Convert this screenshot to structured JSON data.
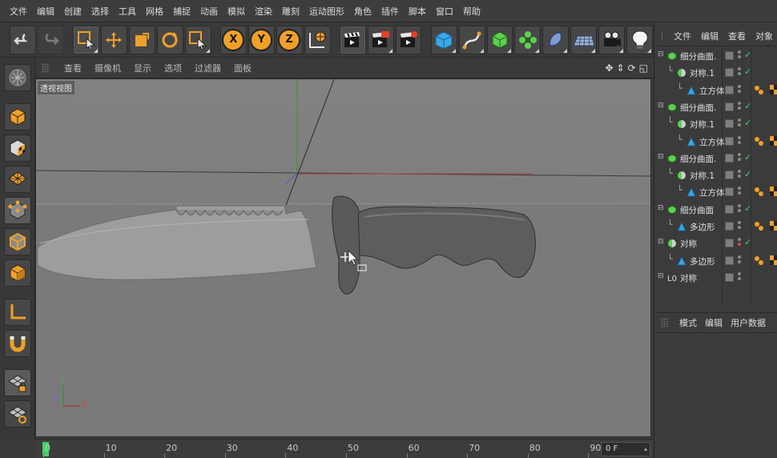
{
  "menu": [
    "文件",
    "编辑",
    "创建",
    "选择",
    "工具",
    "网格",
    "捕捉",
    "动画",
    "模拟",
    "渲染",
    "雕刻",
    "运动图形",
    "角色",
    "插件",
    "脚本",
    "窗口",
    "帮助"
  ],
  "toolbar": {
    "undo_icon": "undo-icon",
    "redo_icon": "redo-icon",
    "axis_x": "X",
    "axis_y": "Y",
    "axis_z": "Z"
  },
  "viewport": {
    "menu": [
      "查看",
      "摄像机",
      "显示",
      "选项",
      "过滤器",
      "面板"
    ],
    "label": "透视视图",
    "axis_y": "Y",
    "axis_z": "Z",
    "axis_x": "X"
  },
  "timeline": {
    "ticks": [
      "0",
      "10",
      "20",
      "30",
      "40",
      "50",
      "60",
      "70",
      "80",
      "90"
    ],
    "frame": "0 F"
  },
  "object_manager": {
    "menu": [
      "文件",
      "编辑",
      "查看",
      "对象"
    ],
    "rows": [
      {
        "name": "细分曲面.",
        "indent": 0,
        "type": "subdiv",
        "check": true
      },
      {
        "name": "对称.1",
        "indent": 1,
        "type": "symmetry",
        "check": true
      },
      {
        "name": "立方体",
        "indent": 2,
        "type": "poly",
        "check": false,
        "tags": true
      },
      {
        "name": "细分曲面.",
        "indent": 0,
        "type": "subdiv",
        "check": true
      },
      {
        "name": "对称.1",
        "indent": 1,
        "type": "symmetry",
        "check": true
      },
      {
        "name": "立方体",
        "indent": 2,
        "type": "poly",
        "check": false,
        "tags": true
      },
      {
        "name": "细分曲面.",
        "indent": 0,
        "type": "subdiv",
        "check": true
      },
      {
        "name": "对称.1",
        "indent": 1,
        "type": "symmetry",
        "check": true
      },
      {
        "name": "立方体",
        "indent": 2,
        "type": "poly",
        "check": false,
        "tags": true
      },
      {
        "name": "细分曲面",
        "indent": 0,
        "type": "subdiv",
        "check": true
      },
      {
        "name": "多边形",
        "indent": 1,
        "type": "poly",
        "check": false,
        "tags": true
      },
      {
        "name": "对称",
        "indent": 0,
        "type": "symmetry",
        "check": true,
        "red": true
      },
      {
        "name": "多边形",
        "indent": 1,
        "type": "poly",
        "check": false,
        "tags": true
      },
      {
        "name": "对称",
        "indent": 0,
        "type": "null",
        "check": false
      }
    ]
  },
  "attributes": {
    "menu": [
      "模式",
      "编辑",
      "用户数据"
    ]
  },
  "colors": {
    "accent": "#f0a02a",
    "check": "#3fd36a",
    "viewport_bg": "#7d7d7d"
  }
}
